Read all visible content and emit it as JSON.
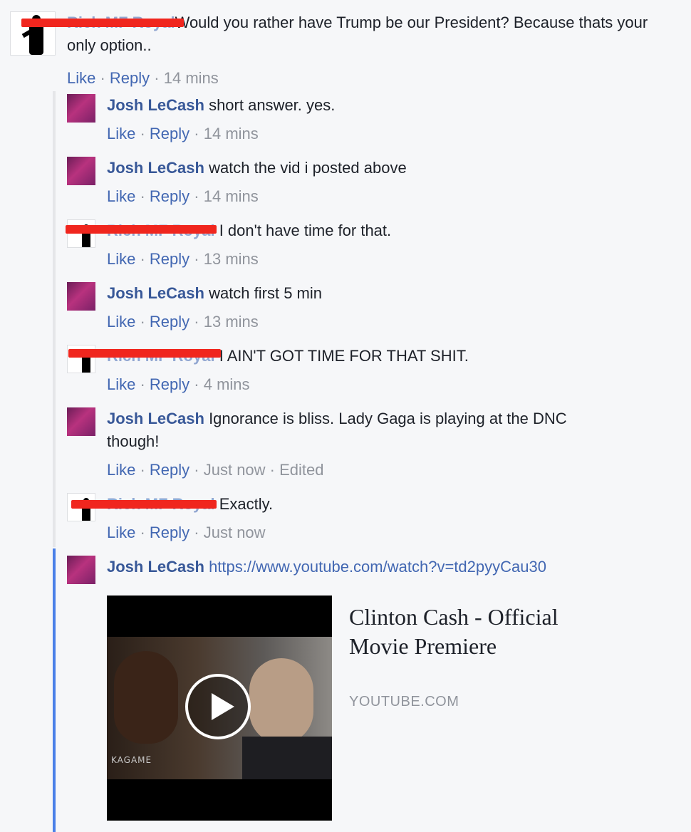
{
  "top_comment": {
    "author_redacted": "Rich MF Royal",
    "text": "Would you rather have Trump be our President? Because thats your only option..",
    "like": "Like",
    "reply": "Reply",
    "time": "14 mins"
  },
  "replies": [
    {
      "author": "Josh LeCash",
      "text": "short answer. yes.",
      "like": "Like",
      "reply": "Reply",
      "time": "14 mins"
    },
    {
      "author": "Josh LeCash",
      "text": "watch the vid i posted above",
      "like": "Like",
      "reply": "Reply",
      "time": "14 mins"
    },
    {
      "author": "Rich MF Royal",
      "text": "I don't have time for that.",
      "like": "Like",
      "reply": "Reply",
      "time": "13 mins"
    },
    {
      "author": "Josh LeCash",
      "text": "watch first 5 min",
      "like": "Like",
      "reply": "Reply",
      "time": "13 mins"
    },
    {
      "author": "Rich MF Royal",
      "text": "I AIN'T GOT TIME FOR THAT SHIT.",
      "like": "Like",
      "reply": "Reply",
      "time": "4 mins"
    },
    {
      "author": "Josh LeCash",
      "text": "Ignorance is bliss. Lady Gaga is playing at the DNC though!",
      "like": "Like",
      "reply": "Reply",
      "time": "Just now",
      "edited": "Edited"
    },
    {
      "author": "Rich MF Royal",
      "text": "Exactly.",
      "like": "Like",
      "reply": "Reply",
      "time": "Just now"
    },
    {
      "author": "Josh LeCash",
      "text": "https://www.youtube.com/watch?v=td2pyyCau30"
    }
  ],
  "link_preview": {
    "title": "Clinton Cash - Official Movie Premiere",
    "domain": "YOUTUBE.COM",
    "thumbnail_caption": "KAGAME"
  },
  "icons": {
    "play": "play-icon",
    "avatar_josh": "avatar-josh-icon",
    "avatar_rich": "avatar-rich-icon"
  },
  "colors": {
    "link": "#4267b2",
    "author": "#385898",
    "meta": "#90949c",
    "redaction": "#f0261e",
    "thread_active": "#4a80e8"
  }
}
